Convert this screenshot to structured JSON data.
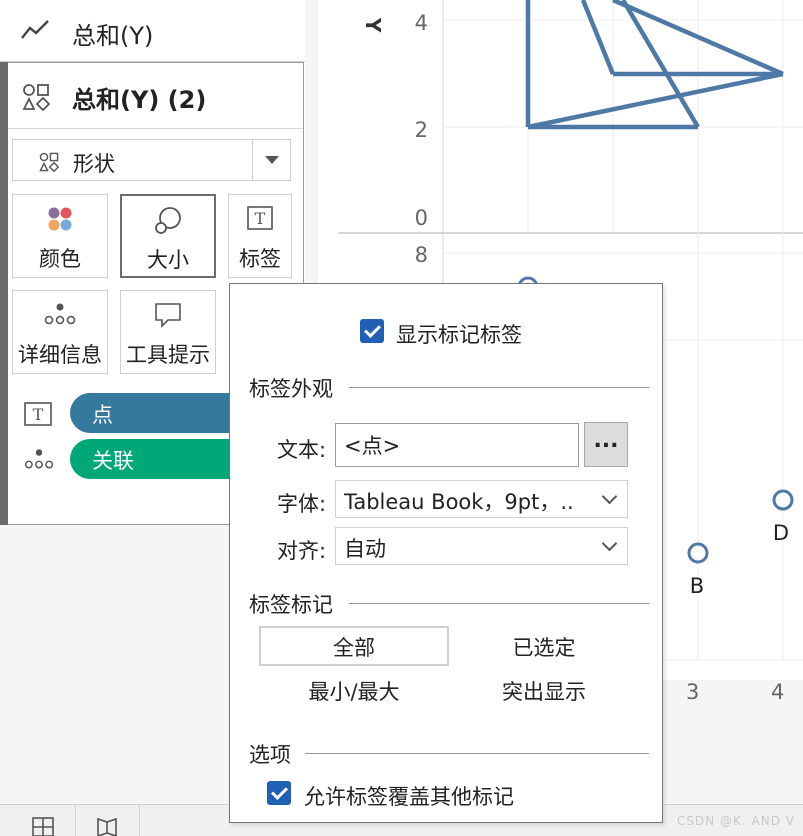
{
  "marks": {
    "row1_label": "总和(Y)",
    "card_title": "总和(Y) (2)",
    "shape_dropdown": "形状",
    "buttons": {
      "color": "颜色",
      "size": "大小",
      "label": "标签",
      "detail": "详细信息",
      "tooltip": "工具提示"
    },
    "pills": [
      {
        "label": "点",
        "color": "#357a9c"
      },
      {
        "label": "关联",
        "color": "#00a878"
      }
    ]
  },
  "chart": {
    "axis_title": "Y",
    "y_ticks_top": [
      "4",
      "2",
      "0"
    ],
    "y_tick_bottom": "8",
    "x_ticks": [
      "3",
      "4"
    ],
    "point_labels": [
      "B",
      "D"
    ]
  },
  "chart_data": {
    "type": "scatter",
    "ylabel": "Y",
    "points_visible": [
      {
        "label": "B",
        "x": 3,
        "y": 2
      },
      {
        "label": "D",
        "x": 4,
        "y": 3
      }
    ],
    "line_color": "#4e79a7",
    "grid": true
  },
  "popup": {
    "show_labels": "显示标记标签",
    "appearance_section": "标签外观",
    "text_label": "文本:",
    "text_value": "<点>",
    "text_button": "...",
    "font_label": "字体:",
    "font_value": "Tableau Book，9pt，..",
    "align_label": "对齐:",
    "align_value": "自动",
    "marks_section": "标签标记",
    "options_marks": {
      "all": "全部",
      "selected": "已选定",
      "minmax": "最小/最大",
      "highlight": "突出显示"
    },
    "options_section": "选项",
    "allow_overlap": "允许标签覆盖其他标记"
  },
  "watermark": "CSDN @K. AND V"
}
